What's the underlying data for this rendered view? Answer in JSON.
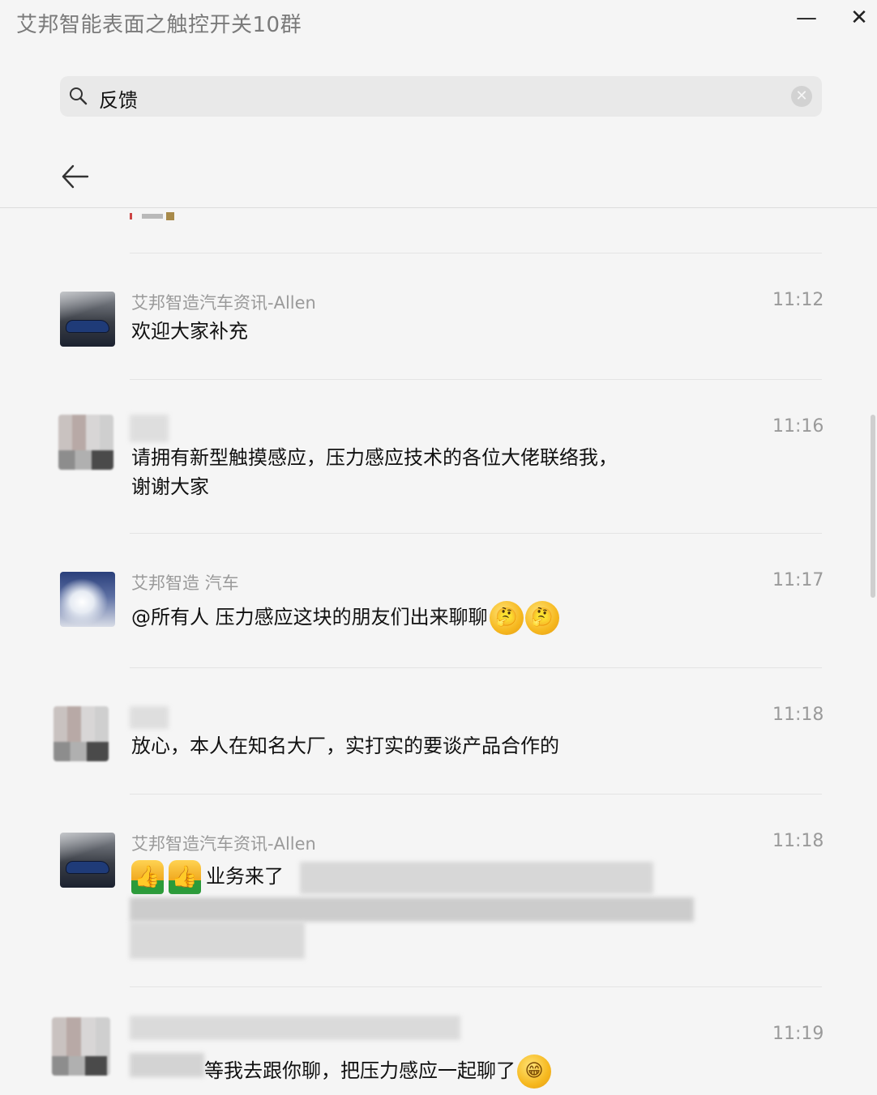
{
  "window": {
    "title": "艾邦智能表面之触控开关10群",
    "minimize_glyph": "—",
    "close_glyph": "✕"
  },
  "search": {
    "query": "反馈",
    "clear_glyph": "✕"
  },
  "messages": [
    {
      "sender": "艾邦智造汽车资讯-Allen",
      "time": "11:12",
      "text": "欢迎大家补充",
      "avatar": "car-photo-avatar"
    },
    {
      "sender": "",
      "time": "11:16",
      "text_line1": "请拥有新型触摸感应，压力感应技术的各位大佬联络我，",
      "text_line2": "谢谢大家",
      "avatar": "blurred-avatar"
    },
    {
      "sender": "艾邦智造 汽车",
      "time": "11:17",
      "text": "@所有人 压力感应这块的朋友们出来聊聊",
      "emoji": "🤔",
      "avatar": "car-photo-avatar"
    },
    {
      "sender": "",
      "time": "11:18",
      "text": "放心，本人在知名大厂，实打实的要谈产品合作的",
      "avatar": "blurred-avatar"
    },
    {
      "sender": "艾邦智造汽车资讯-Allen",
      "time": "11:18",
      "text": "业务来了",
      "thumb": "👍",
      "avatar": "car-photo-avatar"
    },
    {
      "sender": "",
      "time": "11:19",
      "text": "等我去跟你聊，把压力感应一起聊了",
      "emoji": "😁",
      "avatar": "blurred-avatar"
    }
  ],
  "colors": {
    "background": "#f5f5f5",
    "search_bg": "#e9e9e9",
    "secondary_text": "#9a9a9a",
    "divider": "#e4e4e4"
  },
  "icons": [
    "search-icon",
    "clear-icon",
    "back-arrow-icon",
    "minimize-icon",
    "close-icon"
  ]
}
